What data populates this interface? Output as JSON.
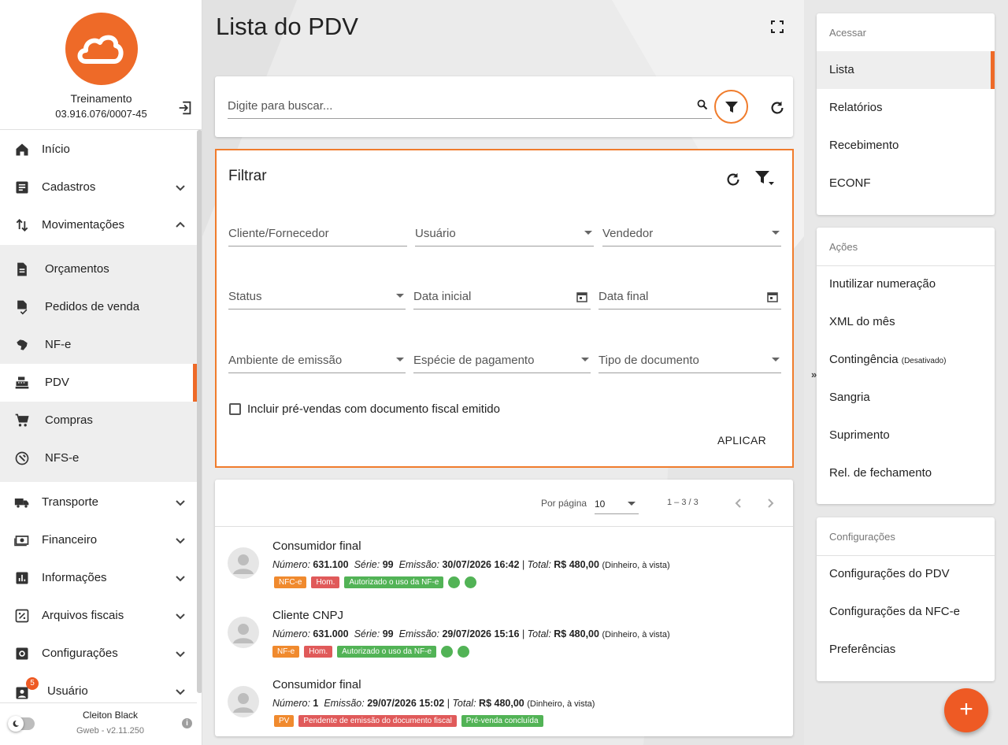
{
  "sidebar": {
    "company": "Treinamento",
    "cnpj": "03.916.076/0007-45",
    "items": [
      {
        "label": "Início"
      },
      {
        "label": "Cadastros"
      },
      {
        "label": "Movimentações"
      },
      {
        "label": "Orçamentos"
      },
      {
        "label": "Pedidos de venda"
      },
      {
        "label": "NF-e"
      },
      {
        "label": "PDV"
      },
      {
        "label": "Compras"
      },
      {
        "label": "NFS-e"
      },
      {
        "label": "Transporte"
      },
      {
        "label": "Financeiro"
      },
      {
        "label": "Informações"
      },
      {
        "label": "Arquivos fiscais"
      },
      {
        "label": "Configurações"
      },
      {
        "label": "Usuário"
      }
    ],
    "user_badge": "5",
    "user_name": "Cleiton Black",
    "version": "Gweb - v2.11.250",
    "accent": "#ee6a28"
  },
  "main": {
    "title": "Lista do PDV",
    "search_placeholder": "Digite para buscar...",
    "filter": {
      "title": "Filtrar",
      "fields": {
        "cliente": "Cliente/Fornecedor",
        "usuario": "Usuário",
        "vendedor": "Vendedor",
        "status": "Status",
        "data_inicial": "Data inicial",
        "data_final": "Data final",
        "ambiente": "Ambiente de emissão",
        "especie": "Espécie de pagamento",
        "tipo_doc": "Tipo de documento"
      },
      "checkbox_label": "Incluir pré-vendas com documento fiscal emitido",
      "apply": "APLICAR"
    },
    "pager": {
      "per_page_label": "Por página",
      "per_page_value": "10",
      "range": "1 – 3 / 3"
    },
    "rows": [
      {
        "name": "Consumidor final",
        "numero_label": "Número:",
        "numero": "631.100",
        "serie_label": "Série:",
        "serie": "99",
        "emissao_label": "Emissão:",
        "emissao": "30/07/2026 16:42",
        "total_label": "Total:",
        "total": "R$ 480,00",
        "pagamento": "(Dinheiro, à vista)",
        "tags": [
          "NFC-e",
          "Hom.",
          "Autorizado o uso da NF-e"
        ]
      },
      {
        "name": "Cliente CNPJ",
        "numero_label": "Número:",
        "numero": "631.000",
        "serie_label": "Série:",
        "serie": "99",
        "emissao_label": "Emissão:",
        "emissao": "29/07/2026 15:16",
        "total_label": "Total:",
        "total": "R$ 480,00",
        "pagamento": "(Dinheiro, à vista)",
        "tags": [
          "NF-e",
          "Hom.",
          "Autorizado o uso da NF-e"
        ]
      },
      {
        "name": "Consumidor final",
        "numero_label": "Número:",
        "numero": "1",
        "emissao_label": "Emissão:",
        "emissao": "29/07/2026 15:02",
        "total_label": "Total:",
        "total": "R$ 480,00",
        "pagamento": "(Dinheiro, à vista)",
        "tags": [
          "PV",
          "Pendente de emissão do documento fiscal",
          "Pré-venda concluída"
        ]
      }
    ]
  },
  "right": {
    "acessar": {
      "title": "Acessar",
      "links": [
        "Lista",
        "Relatórios",
        "Recebimento",
        "ECONF"
      ]
    },
    "acoes": {
      "title": "Ações",
      "links": [
        "Inutilizar numeração",
        "XML do mês",
        "Contingência",
        "Sangria",
        "Suprimento",
        "Rel. de fechamento"
      ],
      "contingencia_note": "(Desativado)"
    },
    "config": {
      "title": "Configurações",
      "links": [
        "Configurações do PDV",
        "Configurações da NFC-e",
        "Preferências"
      ]
    },
    "collapse": "»",
    "fab": "+"
  }
}
